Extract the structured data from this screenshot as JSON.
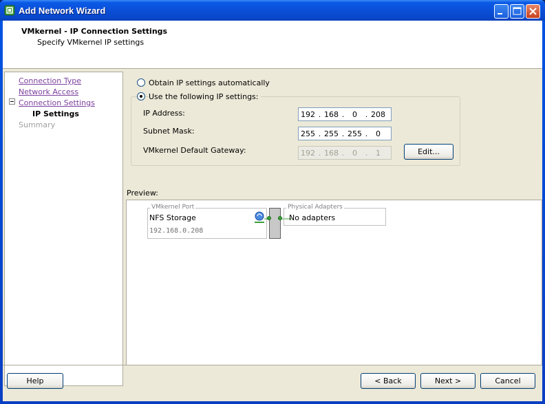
{
  "window": {
    "title": "Add Network Wizard"
  },
  "header": {
    "title": "VMkernel - IP Connection Settings",
    "subtitle": "Specify VMkernel IP settings"
  },
  "nav": {
    "items": [
      {
        "label": "Connection Type",
        "state": "link"
      },
      {
        "label": "Network Access",
        "state": "link"
      },
      {
        "label": "Connection Settings",
        "state": "link"
      },
      {
        "label": "IP Settings",
        "state": "current"
      },
      {
        "label": "Summary",
        "state": "disabled"
      }
    ]
  },
  "ip": {
    "auto_label": "Obtain IP settings automatically",
    "manual_label": "Use the following IP settings:",
    "selected": "manual",
    "address_label": "IP Address:",
    "address": [
      "192",
      "168",
      "0",
      "208"
    ],
    "mask_label": "Subnet Mask:",
    "mask": [
      "255",
      "255",
      "255",
      "0"
    ],
    "gateway_label": "VMkernel Default Gateway:",
    "gateway": [
      "192",
      "168",
      "0",
      "1"
    ],
    "edit_label": "Edit..."
  },
  "preview": {
    "label": "Preview:",
    "port_caption": "VMkernel Port",
    "port_name": "NFS Storage",
    "port_ip": "192.168.0.208",
    "adapters_caption": "Physical Adapters",
    "adapters_value": "No adapters"
  },
  "footer": {
    "help": "Help",
    "back": "< Back",
    "next": "Next >",
    "cancel": "Cancel"
  },
  "colors": {
    "accent": "#0a5ae6",
    "link": "#7b3f9e",
    "disabled": "#a0a0a0"
  }
}
